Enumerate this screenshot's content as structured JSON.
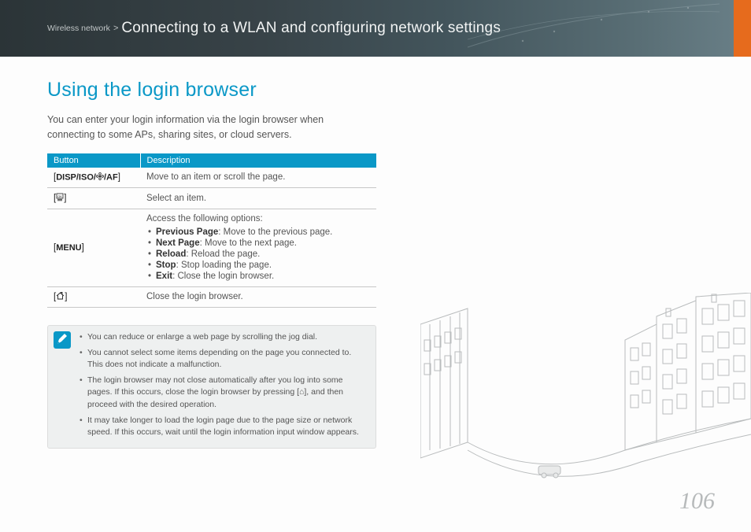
{
  "header": {
    "category": "Wireless network",
    "separator": ">",
    "title": "Connecting to a WLAN and configuring network settings"
  },
  "section_title": "Using the login browser",
  "intro": "You can enter your login information via the login browser when connecting to some APs, sharing sites, or cloud servers.",
  "table": {
    "headers": {
      "button": "Button",
      "description": "Description"
    },
    "rows": [
      {
        "button_prefix": "[",
        "button_label": "DISP/ISO/",
        "button_mid_icon": "flower-macro-icon",
        "button_label2": "/AF",
        "button_suffix": "]",
        "description": "Move to an item or scroll the page."
      },
      {
        "button_prefix": "[",
        "button_icon": "ok-frame-icon",
        "button_suffix": "]",
        "description": "Select an item."
      },
      {
        "button_prefix": "[",
        "button_label": "MENU",
        "button_suffix": "]",
        "description_lead": "Access the following options:",
        "options": [
          {
            "name": "Previous Page",
            "desc": ": Move to the previous page."
          },
          {
            "name": "Next Page",
            "desc": ": Move to the next page."
          },
          {
            "name": "Reload",
            "desc": ": Reload the page."
          },
          {
            "name": "Stop",
            "desc": ": Stop loading the page."
          },
          {
            "name": "Exit",
            "desc": ": Close the login browser."
          }
        ]
      },
      {
        "button_prefix": "[",
        "button_icon": "home-icon",
        "button_suffix": "]",
        "description": "Close the login browser."
      }
    ]
  },
  "notes": {
    "icon": "pencil-note-icon",
    "items": [
      "You can reduce or enlarge a web page by scrolling the jog dial.",
      "You cannot select some items depending on the page you connected to. This does not indicate a malfunction.",
      "The login browser may not close automatically after you log into some pages. If this occurs, close the login browser by pressing [⌂], and then proceed with the desired operation.",
      "It may take longer to load the login page due to the page size or network speed. If this occurs, wait until the login information input window appears."
    ]
  },
  "page_number": "106"
}
